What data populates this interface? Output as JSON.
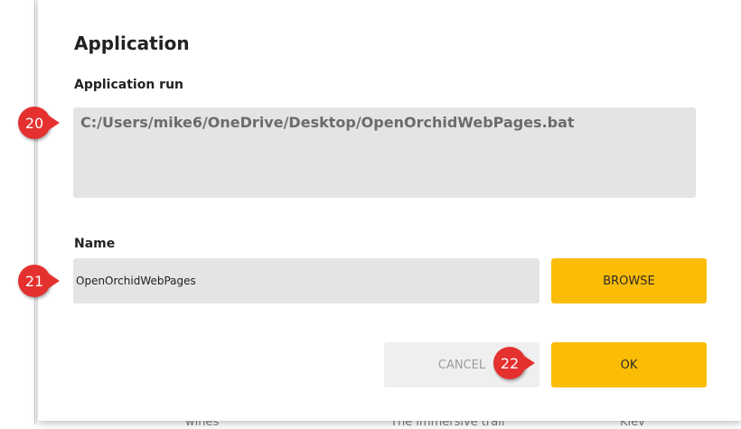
{
  "dialog": {
    "title": "Application",
    "application_run": {
      "label": "Application run",
      "value": "C:/Users/mike6/OneDrive/Desktop/OpenOrchidWebPages.bat"
    },
    "name": {
      "label": "Name",
      "value": "OpenOrchidWebPages"
    },
    "buttons": {
      "browse": "BROWSE",
      "cancel": "CANCEL",
      "ok": "OK"
    }
  },
  "callouts": [
    "20",
    "21",
    "22"
  ],
  "background_text": [
    "wines",
    "The immersive trail",
    "Kiev"
  ],
  "colors": {
    "accent": "#fbbc05",
    "callout": "#e4312f",
    "field_background": "#e4e4e4",
    "disabled_button": "#efefef"
  }
}
